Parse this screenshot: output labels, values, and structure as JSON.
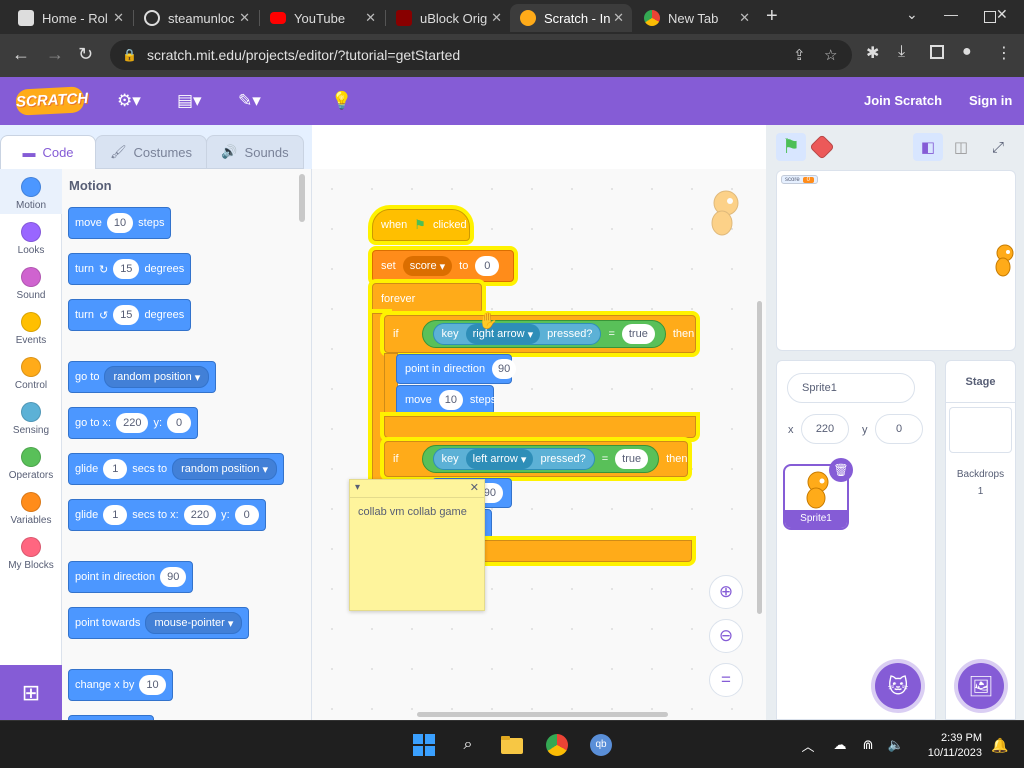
{
  "browser": {
    "tabs": [
      {
        "title": "Home - Rol",
        "active": false
      },
      {
        "title": "steamunloc",
        "active": false
      },
      {
        "title": "YouTube",
        "active": false
      },
      {
        "title": "uBlock Orig",
        "active": false
      },
      {
        "title": "Scratch - In",
        "active": true
      },
      {
        "title": "New Tab",
        "active": false
      }
    ],
    "url": "scratch.mit.edu/projects/editor/?tutorial=getStarted"
  },
  "menubar": {
    "logo": "SCRATCH",
    "join": "Join Scratch",
    "signin": "Sign in"
  },
  "editor_tabs": {
    "code": "Code",
    "costumes": "Costumes",
    "sounds": "Sounds"
  },
  "categories": [
    {
      "label": "Motion",
      "color": "#4c97ff"
    },
    {
      "label": "Looks",
      "color": "#9966ff"
    },
    {
      "label": "Sound",
      "color": "#cf63cf"
    },
    {
      "label": "Events",
      "color": "#ffbf00"
    },
    {
      "label": "Control",
      "color": "#ffab19"
    },
    {
      "label": "Sensing",
      "color": "#5cb1d6"
    },
    {
      "label": "Operators",
      "color": "#59c059"
    },
    {
      "label": "Variables",
      "color": "#ff8c1a"
    },
    {
      "label": "My Blocks",
      "color": "#ff6680"
    }
  ],
  "palette": {
    "title": "Motion",
    "move": {
      "a": "move",
      "v": "10",
      "b": "steps"
    },
    "turn_right": {
      "a": "turn",
      "v": "15",
      "b": "degrees"
    },
    "turn_left": {
      "a": "turn",
      "v": "15",
      "b": "degrees"
    },
    "goto": {
      "a": "go to",
      "d": "random position"
    },
    "goto_xy": {
      "a": "go to x:",
      "x": "220",
      "b": "y:",
      "y": "0"
    },
    "glide": {
      "a": "glide",
      "v": "1",
      "b": "secs to",
      "d": "random position"
    },
    "glide_xy": {
      "a": "glide",
      "v": "1",
      "b": "secs to x:",
      "x": "220",
      "c": "y:",
      "y": "0"
    },
    "point_dir": {
      "a": "point in direction",
      "v": "90"
    },
    "point_towards": {
      "a": "point towards",
      "d": "mouse-pointer"
    },
    "change_x": {
      "a": "change x by",
      "v": "10"
    }
  },
  "script": {
    "hat": {
      "a": "when",
      "b": "clicked"
    },
    "set": {
      "a": "set",
      "var": "score",
      "b": "to",
      "v": "0"
    },
    "forever": "forever",
    "if1": {
      "if": "if",
      "key": "key",
      "d": "right arrow",
      "pressed": "pressed?",
      "eq": "=",
      "val": "true",
      "then": "then"
    },
    "point1": {
      "a": "point in direction",
      "v": "90"
    },
    "move1": {
      "a": "move",
      "v": "10",
      "b": "steps"
    },
    "if2": {
      "if": "if",
      "key": "key",
      "d": "left arrow",
      "pressed": "pressed?",
      "eq": "=",
      "val": "true",
      "then": "then"
    },
    "hidden_value": "-90",
    "comment": "collab vm collab game"
  },
  "stage": {
    "monitor_label": "score",
    "monitor_value": "0"
  },
  "sprite": {
    "name": "Sprite1",
    "x_label": "x",
    "x": "220",
    "y_label": "y",
    "y": "0",
    "thumb_name": "Sprite1"
  },
  "stage_pane": {
    "title": "Stage",
    "backdrops_label": "Backdrops",
    "backdrops_count": "1"
  },
  "taskbar": {
    "time": "2:39 PM",
    "date": "10/11/2023"
  }
}
